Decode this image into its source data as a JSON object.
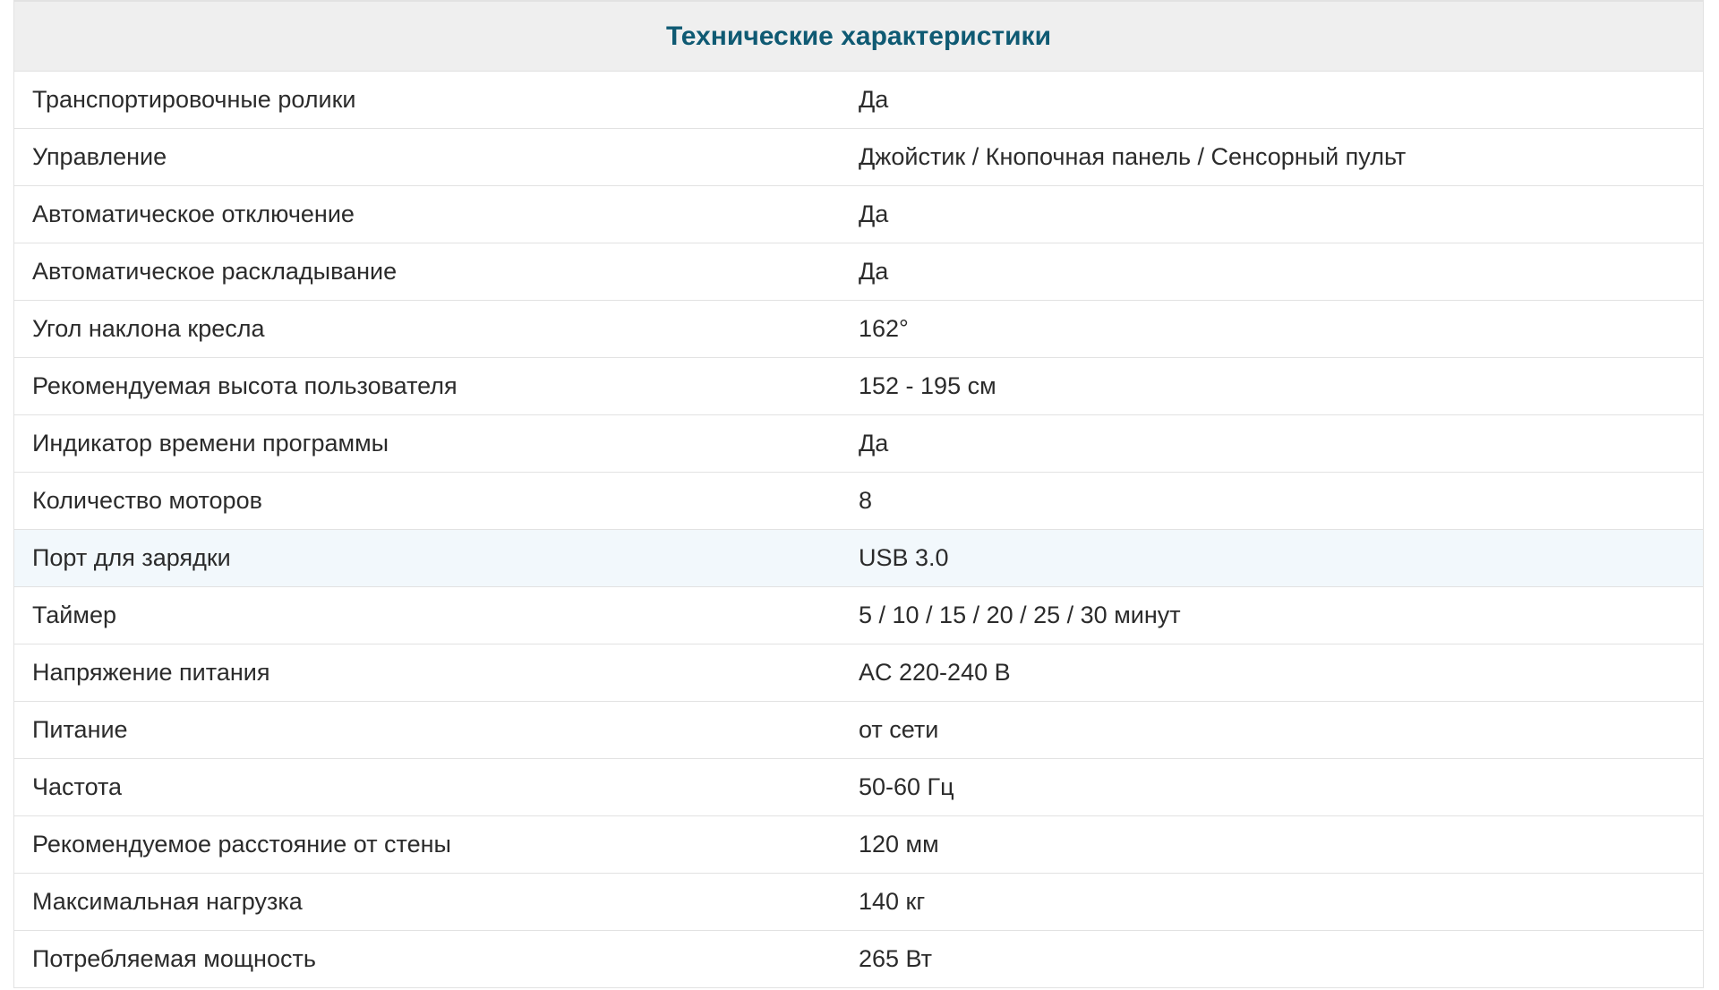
{
  "title": "Технические характеристики",
  "rows": [
    {
      "label": "Транспортировочные ролики",
      "value": "Да"
    },
    {
      "label": "Управление",
      "value": "Джойстик / Кнопочная панель / Сенсорный пульт"
    },
    {
      "label": "Автоматическое отключение",
      "value": "Да"
    },
    {
      "label": "Автоматическое раскладывание",
      "value": "Да"
    },
    {
      "label": "Угол наклона кресла",
      "value": "162°"
    },
    {
      "label": "Рекомендуемая высота пользователя",
      "value": "152 - 195 см"
    },
    {
      "label": "Индикатор времени программы",
      "value": "Да"
    },
    {
      "label": "Количество моторов",
      "value": "8"
    },
    {
      "label": "Порт для зарядки",
      "value": "USB 3.0"
    },
    {
      "label": "Таймер",
      "value": "5 / 10 / 15 / 20 / 25 / 30 минут"
    },
    {
      "label": "Напряжение питания",
      "value": "AC 220-240 В"
    },
    {
      "label": "Питание",
      "value": "от сети"
    },
    {
      "label": "Частота",
      "value": "50-60 Гц"
    },
    {
      "label": "Рекомендуемое расстояние от стены",
      "value": "120 мм"
    },
    {
      "label": "Максимальная нагрузка",
      "value": "140 кг"
    },
    {
      "label": "Потребляемая мощность",
      "value": "265 Вт"
    }
  ],
  "colors": {
    "title": "#0f5a73",
    "header_bg": "#efefef",
    "highlight_row_bg": "#f2f8fc",
    "border": "#e2e2e2",
    "text": "#2b2b2b"
  }
}
